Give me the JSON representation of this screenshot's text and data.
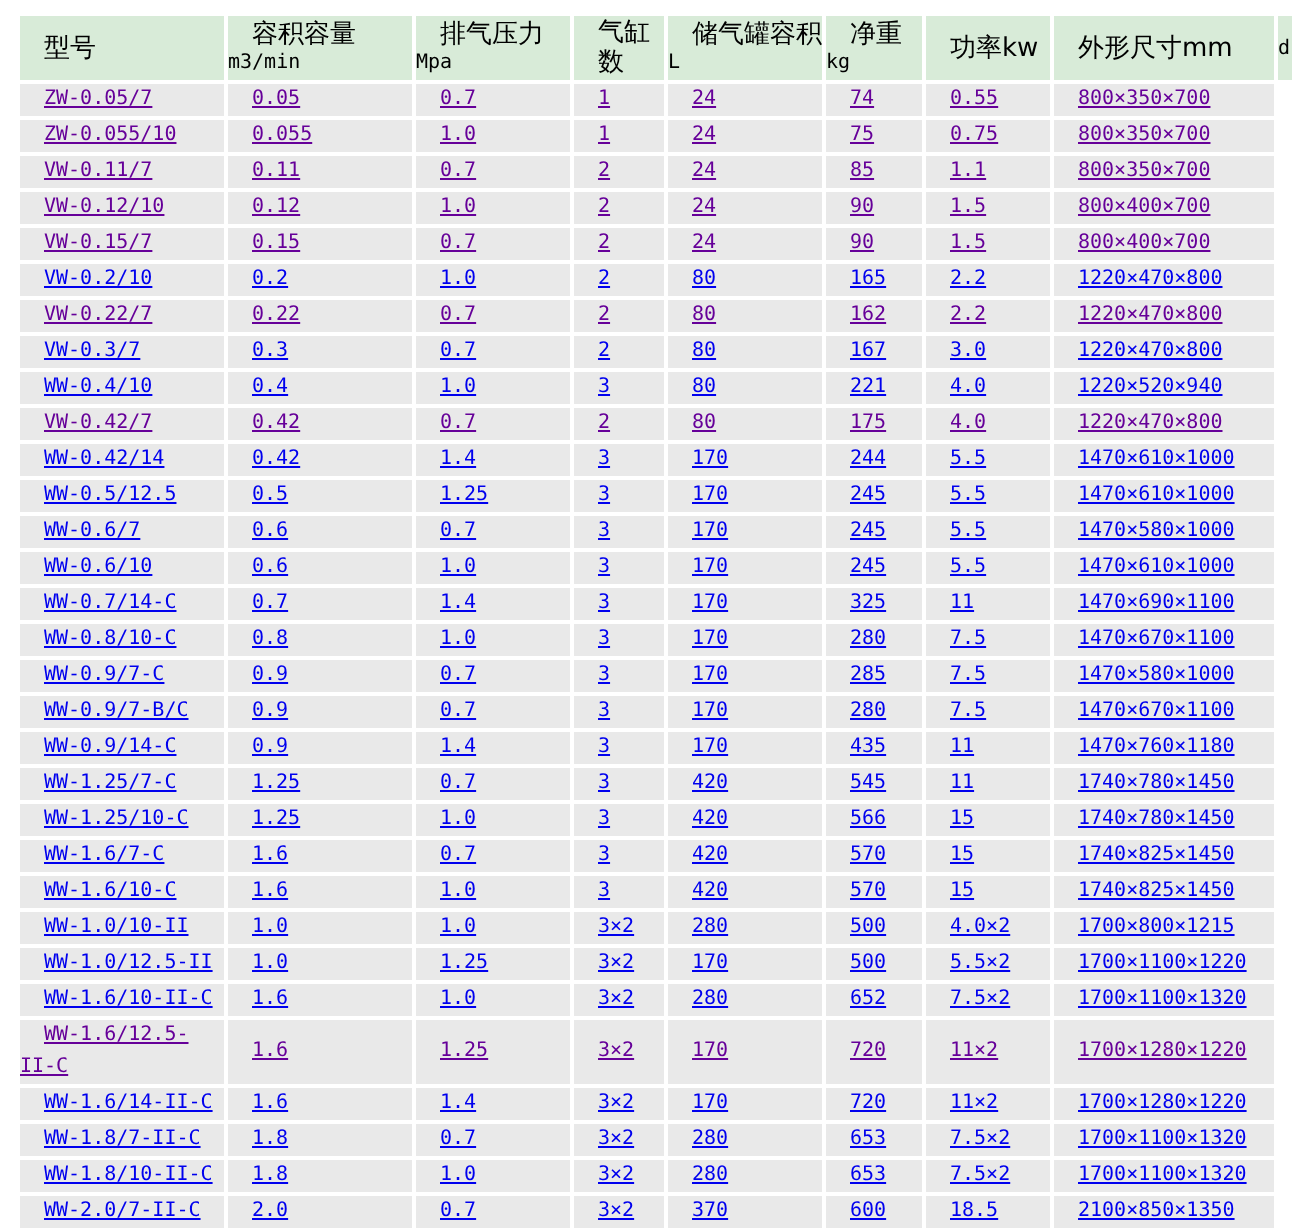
{
  "table": {
    "columns": [
      {
        "title": "型号"
      },
      {
        "title": "容积容量",
        "unit": "m3/min"
      },
      {
        "title": "排气压力",
        "unit": "Mpa"
      },
      {
        "title": "气缸数"
      },
      {
        "title": "储气罐容积",
        "unit": "L"
      },
      {
        "title": "净重",
        "unit": "kg"
      },
      {
        "title": "功率kw"
      },
      {
        "title": "外形尺寸mm"
      },
      {
        "title": "d"
      }
    ],
    "rows": [
      {
        "visited": true,
        "cells": [
          "ZW-0.05/7",
          "0.05",
          "0.7",
          "1",
          "24",
          "74",
          "0.55",
          "800×350×700"
        ]
      },
      {
        "visited": true,
        "cells": [
          "ZW-0.055/10",
          "0.055",
          "1.0",
          "1",
          "24",
          "75",
          "0.75",
          "800×350×700"
        ]
      },
      {
        "visited": true,
        "cells": [
          "VW-0.11/7",
          "0.11",
          "0.7",
          "2",
          "24",
          "85",
          "1.1",
          "800×350×700"
        ]
      },
      {
        "visited": true,
        "cells": [
          "VW-0.12/10",
          "0.12",
          "1.0",
          "2",
          "24",
          "90",
          "1.5",
          "800×400×700"
        ]
      },
      {
        "visited": true,
        "cells": [
          "VW-0.15/7",
          "0.15",
          "0.7",
          "2",
          "24",
          "90",
          "1.5",
          "800×400×700"
        ]
      },
      {
        "visited": false,
        "cells": [
          "VW-0.2/10",
          "0.2",
          "1.0",
          "2",
          "80",
          "165",
          "2.2",
          "1220×470×800"
        ]
      },
      {
        "visited": true,
        "cells": [
          "VW-0.22/7",
          "0.22",
          "0.7",
          "2",
          "80",
          "162",
          "2.2",
          "1220×470×800"
        ]
      },
      {
        "visited": false,
        "cells": [
          "VW-0.3/7",
          "0.3",
          "0.7",
          "2",
          "80",
          "167",
          "3.0",
          "1220×470×800"
        ]
      },
      {
        "visited": false,
        "cells": [
          "WW-0.4/10",
          "0.4",
          "1.0",
          "3",
          "80",
          "221",
          "4.0",
          "1220×520×940"
        ]
      },
      {
        "visited": true,
        "cells": [
          "VW-0.42/7",
          "0.42",
          "0.7",
          "2",
          "80",
          "175",
          "4.0",
          "1220×470×800"
        ]
      },
      {
        "visited": false,
        "cells": [
          "WW-0.42/14",
          "0.42",
          "1.4",
          "3",
          "170",
          "244",
          "5.5",
          "1470×610×1000"
        ]
      },
      {
        "visited": false,
        "cells": [
          "WW-0.5/12.5",
          "0.5",
          "1.25",
          "3",
          "170",
          "245",
          "5.5",
          "1470×610×1000"
        ]
      },
      {
        "visited": false,
        "cells": [
          "WW-0.6/7",
          "0.6",
          "0.7",
          "3",
          "170",
          "245",
          "5.5",
          "1470×580×1000"
        ]
      },
      {
        "visited": false,
        "cells": [
          "WW-0.6/10",
          "0.6",
          "1.0",
          "3",
          "170",
          "245",
          "5.5",
          "1470×610×1000"
        ]
      },
      {
        "visited": false,
        "cells": [
          "WW-0.7/14-C",
          "0.7",
          "1.4",
          "3",
          "170",
          "325",
          "11",
          "1470×690×1100"
        ]
      },
      {
        "visited": false,
        "cells": [
          "WW-0.8/10-C",
          "0.8",
          "1.0",
          "3",
          "170",
          "280",
          "7.5",
          "1470×670×1100"
        ]
      },
      {
        "visited": false,
        "cells": [
          "WW-0.9/7-C",
          "0.9",
          "0.7",
          "3",
          "170",
          "285",
          "7.5",
          "1470×580×1000"
        ]
      },
      {
        "visited": false,
        "cells": [
          "WW-0.9/7-B/C",
          "0.9",
          "0.7",
          "3",
          "170",
          "280",
          "7.5",
          "1470×670×1100"
        ]
      },
      {
        "visited": false,
        "cells": [
          "WW-0.9/14-C",
          "0.9",
          "1.4",
          "3",
          "170",
          "435",
          "11",
          "1470×760×1180"
        ]
      },
      {
        "visited": false,
        "cells": [
          "WW-1.25/7-C",
          "1.25",
          "0.7",
          "3",
          "420",
          "545",
          "11",
          "1740×780×1450"
        ]
      },
      {
        "visited": false,
        "cells": [
          "WW-1.25/10-C",
          "1.25",
          "1.0",
          "3",
          "420",
          "566",
          "15",
          "1740×780×1450"
        ]
      },
      {
        "visited": false,
        "cells": [
          "WW-1.6/7-C",
          "1.6",
          "0.7",
          "3",
          "420",
          "570",
          "15",
          "1740×825×1450"
        ]
      },
      {
        "visited": false,
        "cells": [
          "WW-1.6/10-C",
          "1.6",
          "1.0",
          "3",
          "420",
          "570",
          "15",
          "1740×825×1450"
        ]
      },
      {
        "visited": false,
        "cells": [
          "WW-1.0/10-II",
          "1.0",
          "1.0",
          "3×2",
          "280",
          "500",
          "4.0×2",
          "1700×800×1215"
        ]
      },
      {
        "visited": false,
        "cells": [
          "WW-1.0/12.5-II",
          "1.0",
          "1.25",
          "3×2",
          "170",
          "500",
          "5.5×2",
          "1700×1100×1220"
        ]
      },
      {
        "visited": false,
        "cells": [
          "WW-1.6/10-II-C",
          "1.6",
          "1.0",
          "3×2",
          "280",
          "652",
          "7.5×2",
          "1700×1100×1320"
        ]
      },
      {
        "visited": true,
        "cells": [
          "WW-1.6/12.5-II-C",
          "1.6",
          "1.25",
          "3×2",
          "170",
          "720",
          "11×2",
          "1700×1280×1220"
        ]
      },
      {
        "visited": false,
        "cells": [
          "WW-1.6/14-II-C",
          "1.6",
          "1.4",
          "3×2",
          "170",
          "720",
          "11×2",
          "1700×1280×1220"
        ]
      },
      {
        "visited": false,
        "cells": [
          "WW-1.8/7-II-C",
          "1.8",
          "0.7",
          "3×2",
          "280",
          "653",
          "7.5×2",
          "1700×1100×1320"
        ]
      },
      {
        "visited": false,
        "cells": [
          "WW-1.8/10-II-C",
          "1.8",
          "1.0",
          "3×2",
          "280",
          "653",
          "7.5×2",
          "1700×1100×1320"
        ]
      },
      {
        "visited": false,
        "cells": [
          "WW-2.0/7-II-C",
          "2.0",
          "0.7",
          "3×2",
          "370",
          "600",
          "18.5",
          "2100×850×1350"
        ]
      }
    ]
  }
}
